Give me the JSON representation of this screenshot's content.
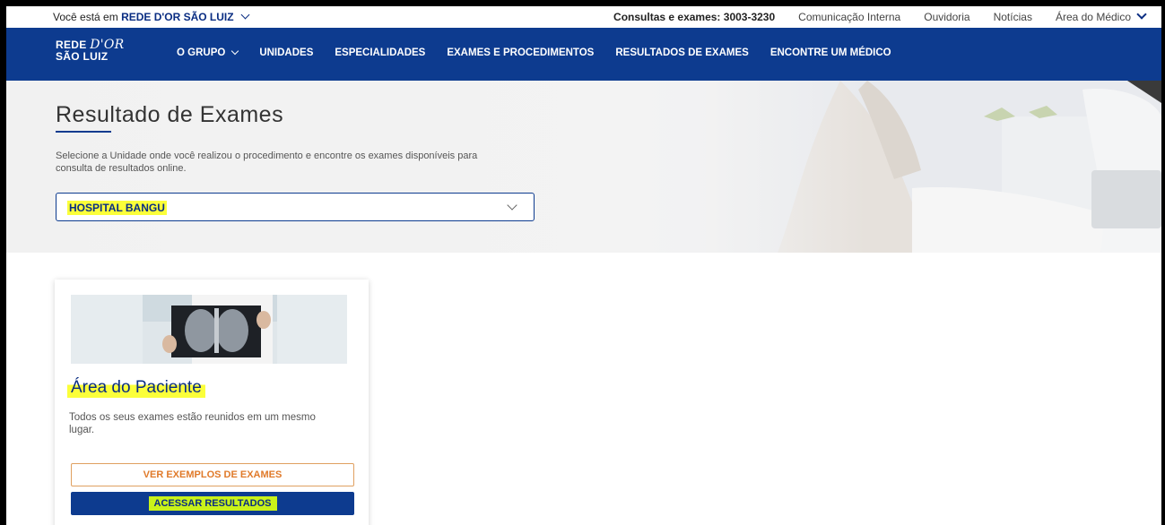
{
  "topbar": {
    "location_prefix": "Você está em",
    "location_name": "REDE D'OR SÃO LUIZ",
    "links": [
      "Consultas e exames: 3003-3230",
      "Comunicação Interna",
      "Ouvidoria",
      "Notícias",
      "Área do Médico"
    ]
  },
  "logo": {
    "line1_a": "REDE ",
    "line1_b": "D'OR",
    "line2": "SÃO LUIZ"
  },
  "nav": {
    "items": [
      "O GRUPO",
      "UNIDADES",
      "ESPECIALIDADES",
      "EXAMES E PROCEDIMENTOS",
      "RESULTADOS DE EXAMES",
      "ENCONTRE UM MÉDICO"
    ]
  },
  "hero": {
    "title": "Resultado de Exames",
    "description": "Selecione a Unidade onde você realizou o procedimento e encontre os exames disponíveis para consulta de resultados online.",
    "select_value": "HOSPITAL BANGU"
  },
  "card": {
    "title": "Área do Paciente",
    "text": "Todos os seus exames estão reunidos em um mesmo lugar.",
    "examples_button": "VER EXEMPLOS DE EXAMES",
    "access_button": "ACESSAR RESULTADOS"
  },
  "colors": {
    "brand_blue": "#0d3b8f",
    "highlight_yellow": "#fbff3a",
    "accent_orange": "#e07a2a"
  },
  "icons": [
    "chevron-down-icon",
    "lungs-xray-image",
    "doctor-photo"
  ]
}
